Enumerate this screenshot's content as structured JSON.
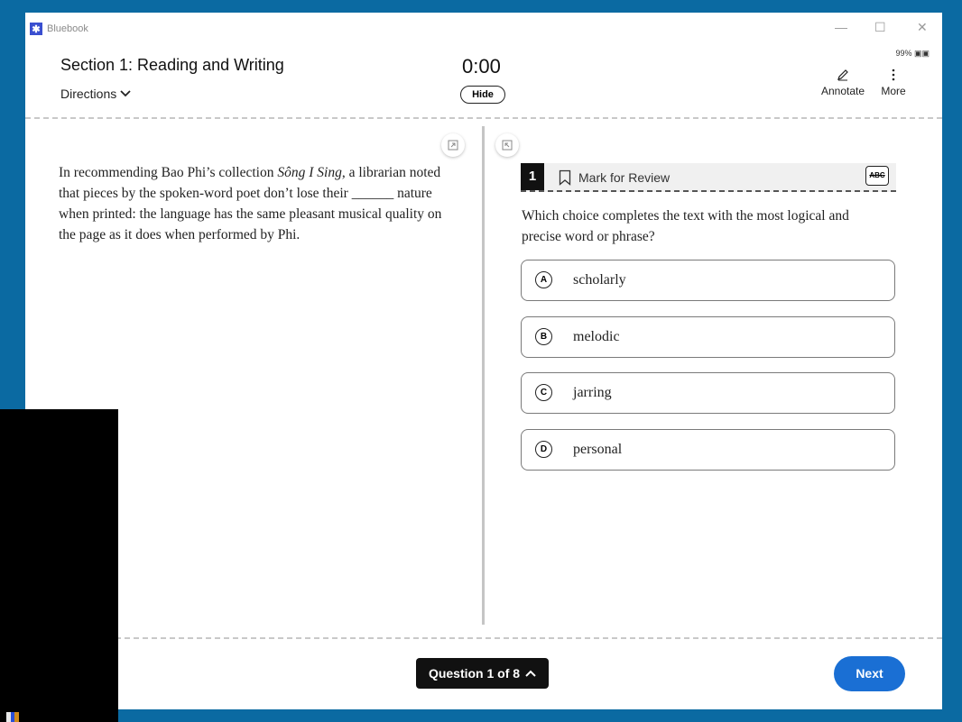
{
  "app": {
    "title": "Bluebook",
    "logo_glyph": "✱"
  },
  "window_controls": {
    "minimize": "—",
    "maximize": "☐",
    "close": "✕"
  },
  "status": {
    "battery": "99% ▣▣"
  },
  "header": {
    "section_title": "Section 1: Reading and Writing",
    "directions_label": "Directions",
    "timer": "0:00",
    "hide_label": "Hide",
    "annotate_label": "Annotate",
    "more_label": "More"
  },
  "passage": {
    "before_title": "In recommending Bao Phi’s collection ",
    "title": "Sông I Sing",
    "after_title": ", a librarian noted that pieces by the spoken-word poet don’t lose their ______ nature when printed: the language has the same pleasant musical quality on the page as it does when performed by Phi."
  },
  "question": {
    "number": "1",
    "mark_for_review_label": "Mark for Review",
    "abc_label": "ABC",
    "prompt": "Which choice completes the text with the most logical and precise word or phrase?",
    "choices": [
      {
        "letter": "A",
        "text": "scholarly"
      },
      {
        "letter": "B",
        "text": "melodic"
      },
      {
        "letter": "C",
        "text": "jarring"
      },
      {
        "letter": "D",
        "text": "personal"
      }
    ]
  },
  "footer": {
    "question_nav_label": "Question 1 of 8",
    "next_label": "Next"
  },
  "colors": {
    "frame": "#0b6aa2",
    "accent": "#1a6fd4",
    "nav_button": "#111111"
  },
  "icons": {
    "chevron_down": "chevron-down-icon",
    "chevron_up": "chevron-up-icon",
    "bookmark": "bookmark-icon",
    "pencil": "pencil-icon",
    "more": "vertical-dots-icon",
    "expand": "expand-icon",
    "collapse": "collapse-icon"
  }
}
